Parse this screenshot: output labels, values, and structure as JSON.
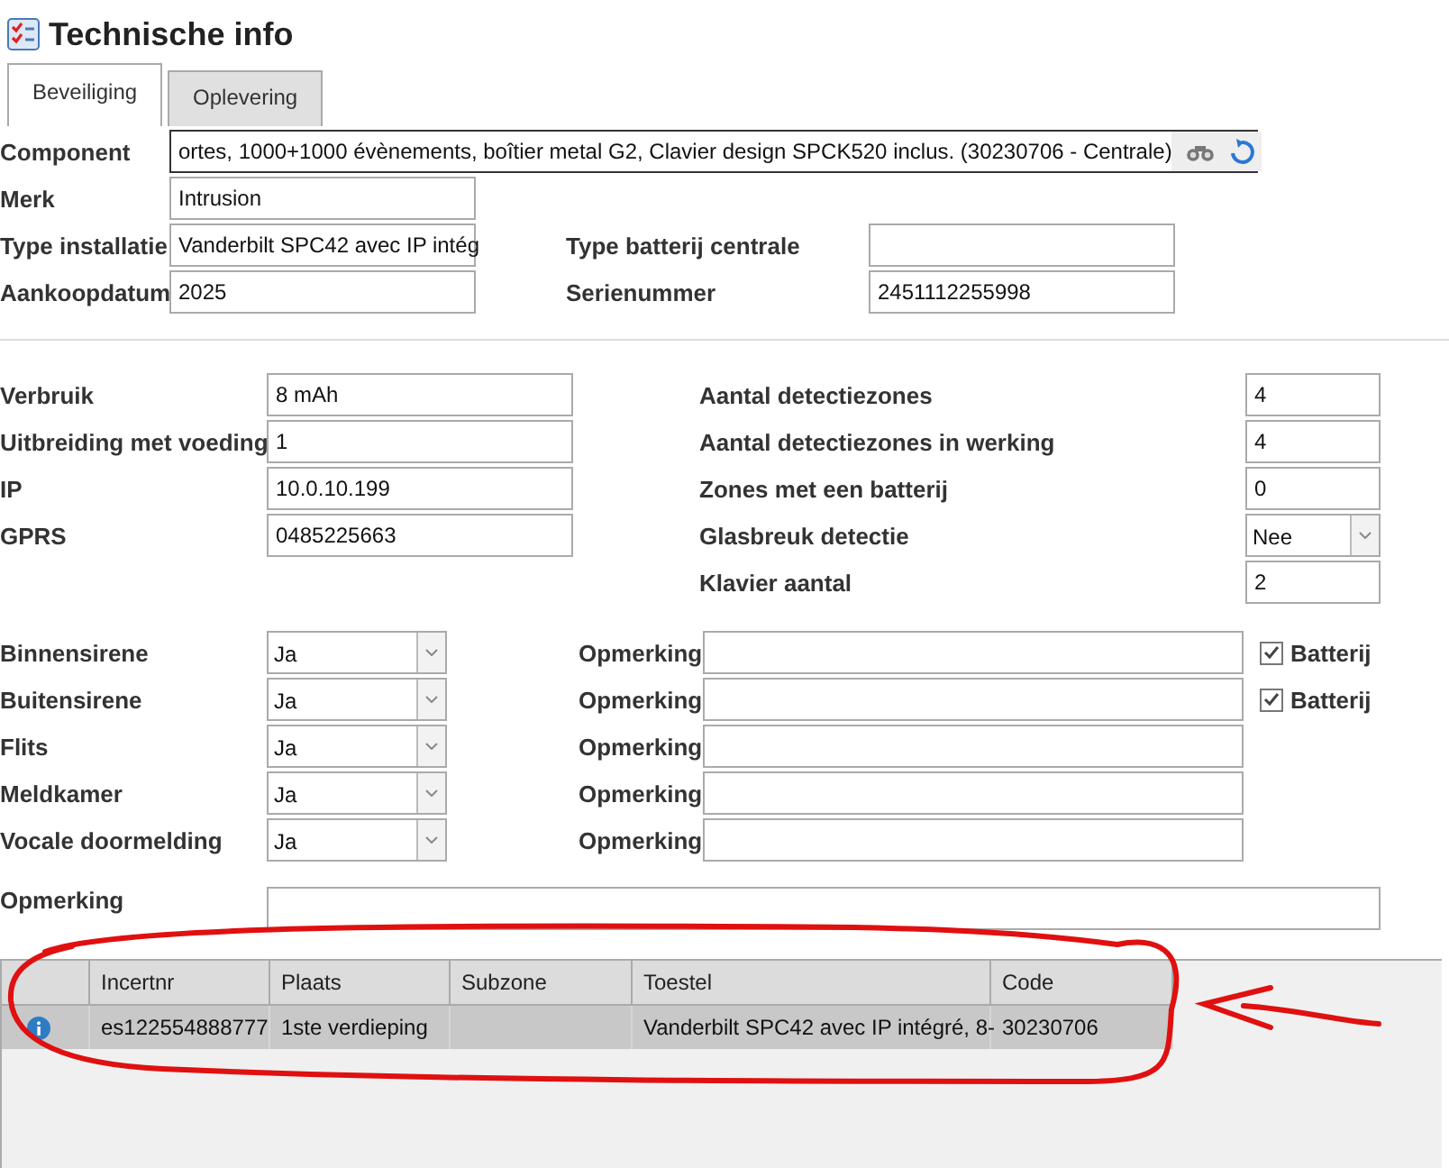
{
  "window": {
    "title": "Technische info"
  },
  "tabs": [
    {
      "label": "Beveiliging",
      "selected": true
    },
    {
      "label": "Oplevering",
      "selected": false
    }
  ],
  "component": {
    "label": "Component",
    "value": "ortes, 1000+1000 évènements, boîtier metal G2, Clavier design SPCK520 inclus. (30230706 - Centrale)"
  },
  "left_fields": [
    {
      "label": "Merk",
      "value": "Intrusion"
    },
    {
      "label": "Type installatie",
      "value": "Vanderbilt SPC42 avec IP intég"
    },
    {
      "label": "Aankoopdatum",
      "value": "2025"
    }
  ],
  "right_fields": [
    {
      "label": "Type batterij centrale"
    },
    {
      "label": "Serienummer",
      "value": "2451112255998"
    }
  ],
  "specs_left": [
    {
      "label": "Verbruik",
      "value": "8 mAh"
    },
    {
      "label": "Uitbreiding met voeding",
      "value": "1"
    },
    {
      "label": "IP",
      "value": "10.0.10.199"
    },
    {
      "label": "GPRS",
      "value": "0485225663"
    }
  ],
  "specs_right": [
    {
      "kind": "input",
      "label": "Aantal detectiezones",
      "value": "4"
    },
    {
      "kind": "input",
      "label": "Aantal detectiezones in werking",
      "value": "4"
    },
    {
      "kind": "input",
      "label": "Zones met een batterij",
      "value": "0"
    },
    {
      "kind": "select",
      "label": "Glasbreuk detectie",
      "value": "Nee"
    },
    {
      "kind": "input",
      "label": "Klavier aantal",
      "value": "2"
    }
  ],
  "devices": [
    {
      "label": "Binnensirene",
      "value": "Ja",
      "remark_label": "Opmerking",
      "battery": {
        "label": "Batterij",
        "checked": true
      }
    },
    {
      "label": "Buitensirene",
      "value": "Ja",
      "remark_label": "Opmerking",
      "battery": {
        "label": "Batterij",
        "checked": true
      }
    },
    {
      "label": "Flits",
      "value": "Ja",
      "remark_label": "Opmerking"
    },
    {
      "label": "Meldkamer",
      "value": "Ja",
      "remark_label": "Opmerking"
    },
    {
      "label": "Vocale doormelding",
      "value": "Ja",
      "remark_label": "Opmerking"
    }
  ],
  "remark": {
    "label": "Opmerking"
  },
  "grid": {
    "columns": [
      "Incertnr",
      "Plaats",
      "Subzone",
      "Toestel",
      "Code"
    ],
    "rows": [
      {
        "selected": true,
        "incertnr": "es122554888777",
        "plaats": "1ste verdieping",
        "toestel": "Vanderbilt SPC42 avec IP intégré, 8-",
        "code": "30230706"
      }
    ]
  },
  "annotations": {
    "circle": true,
    "arrow": true
  }
}
